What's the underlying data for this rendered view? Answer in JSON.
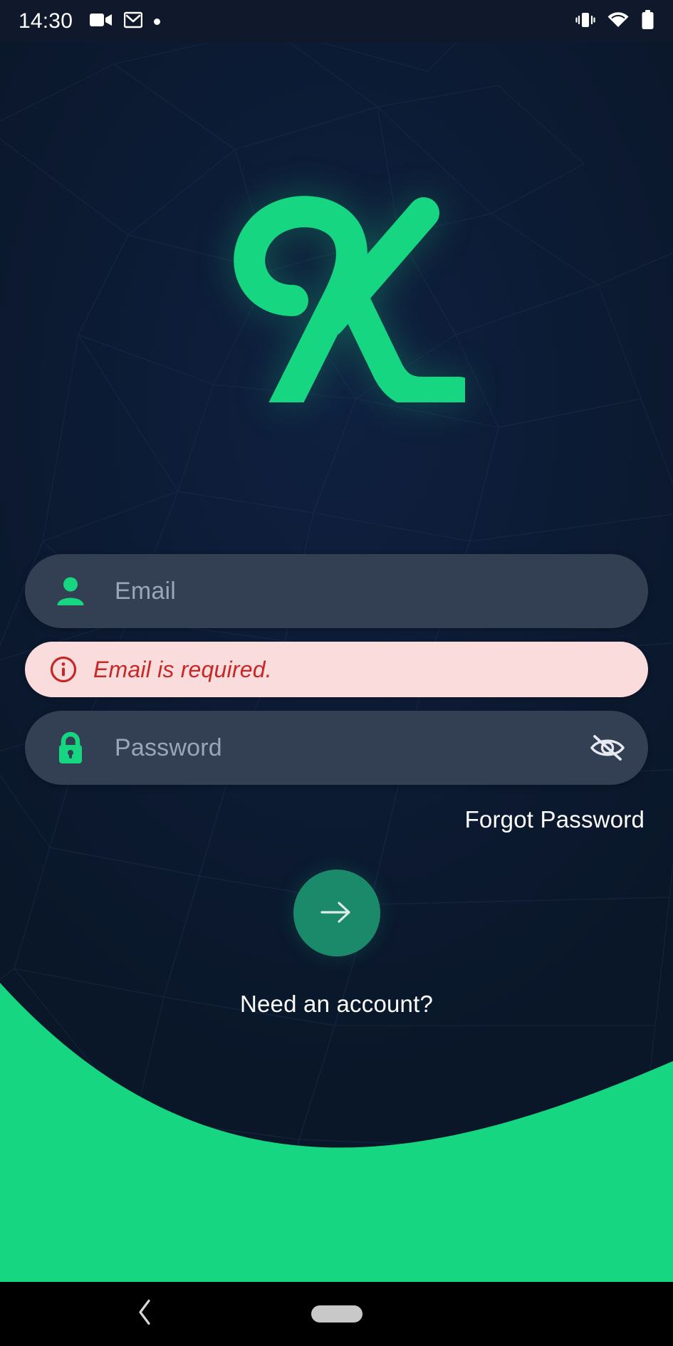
{
  "status_bar": {
    "time": "14:30",
    "left_icons": [
      "video-camera-icon",
      "gmail-icon",
      "dot-indicator-icon"
    ],
    "right_icons": [
      "vibrate-icon",
      "wifi-icon",
      "battery-full-icon"
    ]
  },
  "brand": {
    "logo_icon": "cursive-k-logo",
    "logo_color": "#16d681",
    "background_color": "#0c1a32"
  },
  "form": {
    "email": {
      "icon": "person-icon",
      "placeholder": "Email",
      "value": ""
    },
    "error": {
      "icon": "info-circle-icon",
      "message": "Email is required.",
      "background_color": "#fbdcdc",
      "text_color": "#c62828"
    },
    "password": {
      "icon": "lock-icon",
      "placeholder": "Password",
      "value": "",
      "visibility_toggle_icon": "eye-off-icon"
    },
    "forgot_password_label": "Forgot Password",
    "submit": {
      "icon": "arrow-right-icon",
      "color": "#1b8a6b"
    },
    "need_account_label": "Need an account?"
  },
  "decoration": {
    "wave_color": "#16d681"
  },
  "nav_bar": {
    "back_icon": "chevron-left-icon",
    "home_icon": "home-pill-icon"
  }
}
